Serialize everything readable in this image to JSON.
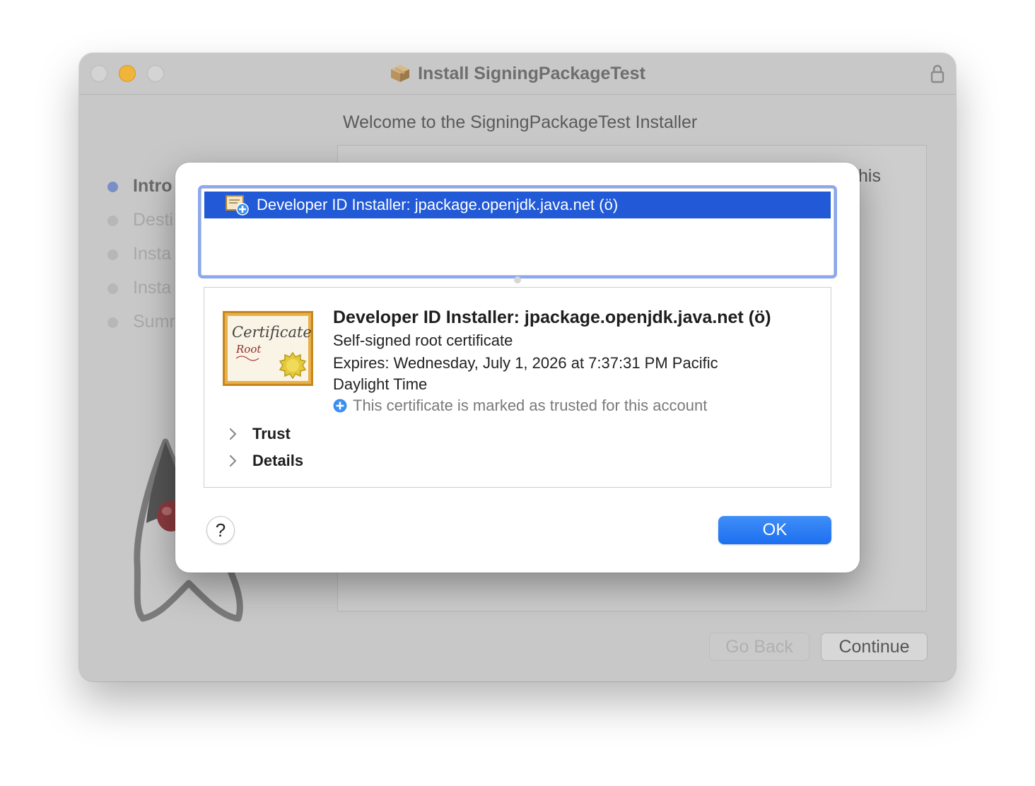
{
  "window": {
    "title": "Install SigningPackageTest",
    "heading": "Welcome to the SigningPackageTest Installer",
    "panel_peek_text": "his",
    "steps": [
      {
        "label": "Intro",
        "active": true
      },
      {
        "label": "Desti",
        "active": false
      },
      {
        "label": "Insta",
        "active": false
      },
      {
        "label": "Insta",
        "active": false
      },
      {
        "label": "Sumr",
        "active": false
      }
    ],
    "buttons": {
      "back": "Go Back",
      "continue": "Continue"
    }
  },
  "sheet": {
    "list_item": "Developer ID Installer: jpackage.openjdk.java.net (ö)",
    "detail": {
      "title": "Developer ID Installer: jpackage.openjdk.java.net (ö)",
      "subtitle": "Self-signed root certificate",
      "expires_line1": "Expires: Wednesday, July 1, 2026 at 7:37:31 PM Pacific",
      "expires_line2": "Daylight Time",
      "trust_status": "This certificate is marked as trusted for this account",
      "sections": {
        "trust": "Trust",
        "details": "Details"
      },
      "icon_text": {
        "line1": "Certificate",
        "line2": "Root"
      }
    },
    "help_label": "?",
    "ok_label": "OK"
  },
  "colors": {
    "selection": "#2159d6",
    "ok_button": "#1d6ff0",
    "focus_ring": "#8aa8f0",
    "window_bg": "#c8c8c8"
  },
  "icons": [
    "package-icon",
    "lock-icon",
    "certificate-icon",
    "trusted-plus-icon",
    "chevron-right-icon",
    "duke-mascot"
  ]
}
